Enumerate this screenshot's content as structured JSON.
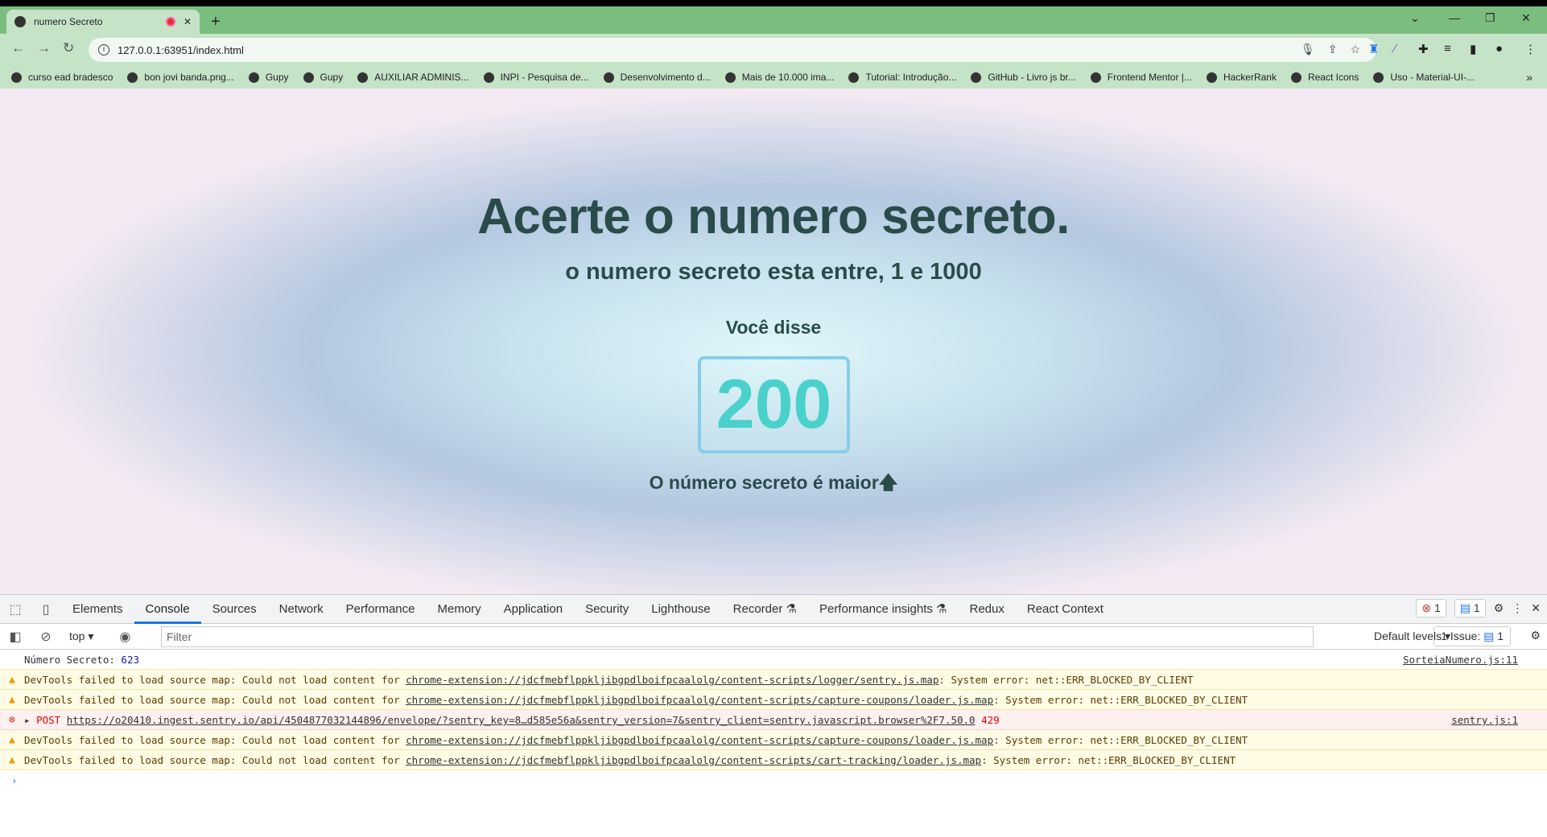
{
  "browser": {
    "tab_title": "numero Secreto",
    "url": "127.0.0.1:63951/index.html",
    "bookmarks": [
      "curso ead bradesco",
      "bon jovi banda.png...",
      "Gupy",
      "Gupy",
      "AUXILIAR ADMINIS...",
      "INPI - Pesquisa de...",
      "Desenvolvimento d...",
      "Mais de 10.000 ima...",
      "Tutorial: Introdução...",
      "GitHub - Livro js br...",
      "Frontend Mentor |...",
      "HackerRank",
      "React Icons",
      "Uso - Material-UI-..."
    ]
  },
  "page": {
    "title": "Acerte o numero secreto.",
    "subtitle": "o numero secreto esta entre, 1 e 1000",
    "said_label": "Você disse",
    "guess": "200",
    "result": "O número secreto é maior",
    "result_icon": "arrow-up",
    "colors": {
      "text": "#2b4b4b",
      "guess": "#4ad1cb",
      "box_border": "#87cde8"
    }
  },
  "devtools": {
    "tabs": [
      "Elements",
      "Console",
      "Sources",
      "Network",
      "Performance",
      "Memory",
      "Application",
      "Security",
      "Lighthouse",
      "Recorder ⚗",
      "Performance insights ⚗",
      "Redux",
      "React Context"
    ],
    "active_tab": "Console",
    "error_count": "1",
    "message_count": "1",
    "context": "top",
    "filter_placeholder": "Filter",
    "levels": "Default levels",
    "issues": "1 Issue:",
    "issues_count": "1",
    "log": {
      "text": "Número Secreto: ",
      "value": "623",
      "source": "SorteiaNumero.js:11"
    },
    "warn_prefix": "DevTools failed to load source map: Could not load content for ",
    "warn_suffix": ": System error: net::ERR_BLOCKED_BY_CLIENT",
    "warnings": [
      "chrome-extension://jdcfmebflppkljibgpdlboifpcaalolg/content-scripts/logger/sentry.js.map",
      "chrome-extension://jdcfmebflppkljibgpdlboifpcaalolg/content-scripts/capture-coupons/loader.js.map",
      "chrome-extension://jdcfmebflppkljibgpdlboifpcaalolg/content-scripts/capture-coupons/loader.js.map",
      "chrome-extension://jdcfmebflppkljibgpdlboifpcaalolg/content-scripts/cart-tracking/loader.js.map"
    ],
    "error": {
      "method": "POST",
      "url": "https://o20410.ingest.sentry.io/api/4504877032144896/envelope/?sentry_key=8…d585e56a&sentry_version=7&sentry_client=sentry.javascript.browser%2F7.50.0",
      "status": "429",
      "source": "sentry.js:1"
    }
  }
}
